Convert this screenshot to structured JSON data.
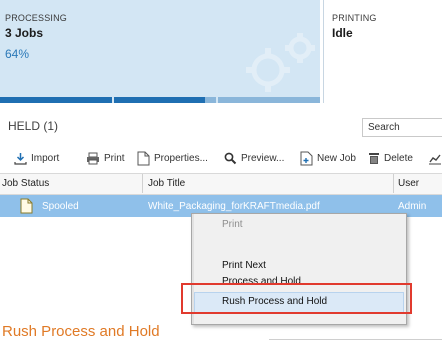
{
  "processing": {
    "label": "PROCESSING",
    "value": "3 Jobs",
    "percent": "64%",
    "progress_fraction": 0.64
  },
  "printing": {
    "label": "PRINTING",
    "value": "Idle"
  },
  "held": {
    "title": "HELD (1)"
  },
  "search": {
    "placeholder": "Search"
  },
  "toolbar": {
    "import": "Import",
    "print": "Print",
    "properties": "Properties...",
    "preview": "Preview...",
    "new_job": "New Job",
    "delete": "Delete"
  },
  "table": {
    "headers": [
      "Job Status",
      "Job Title",
      "User"
    ],
    "rows": [
      {
        "status": "Spooled",
        "title": "White_Packaging_forKRAFTmedia.pdf",
        "user": "Admin"
      }
    ]
  },
  "context_menu": {
    "items": [
      {
        "label": "Print",
        "disabled": true
      },
      {
        "label": "Print Next",
        "disabled": false
      },
      {
        "label": "Process and Hold",
        "disabled": false
      },
      {
        "label": "Rush Process and Hold",
        "disabled": false,
        "highlighted": true
      }
    ]
  },
  "caption": "Rush Process and Hold",
  "colors": {
    "accent": "#1f6fb2",
    "selection": "#8fc0ea",
    "highlight_box": "#e13a2e",
    "caption": "#e07a26"
  }
}
